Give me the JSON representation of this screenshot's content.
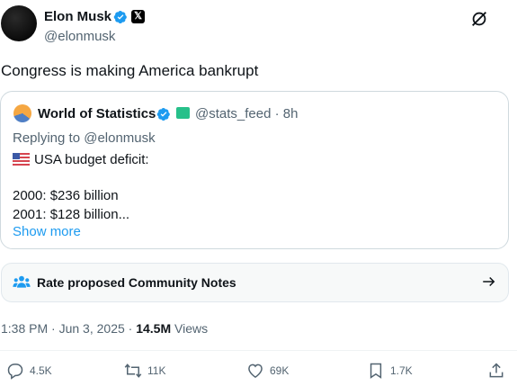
{
  "author": {
    "name": "Elon Musk",
    "handle": "@elonmusk"
  },
  "tweet": {
    "text": "Congress is making America bankrupt"
  },
  "quoted": {
    "name": "World of Statistics",
    "handle": "@stats_feed",
    "time": "· 8h",
    "replying_to": "Replying to @elonmusk",
    "lines": [
      "USA budget deficit:",
      "2000: $236 billion",
      "2001: $128 billion..."
    ],
    "show_more": "Show more"
  },
  "community_notes": {
    "label": "Rate proposed Community Notes"
  },
  "meta": {
    "time": "1:38 PM",
    "date": "Jun 3, 2025",
    "views_count": "14.5M",
    "views_label": "Views"
  },
  "actions": {
    "reply": "4.5K",
    "repost": "11K",
    "like": "69K",
    "bookmark": "1.7K"
  },
  "colors": {
    "accent": "#1d9bf0",
    "text": "#0f1419",
    "muted": "#536471"
  }
}
